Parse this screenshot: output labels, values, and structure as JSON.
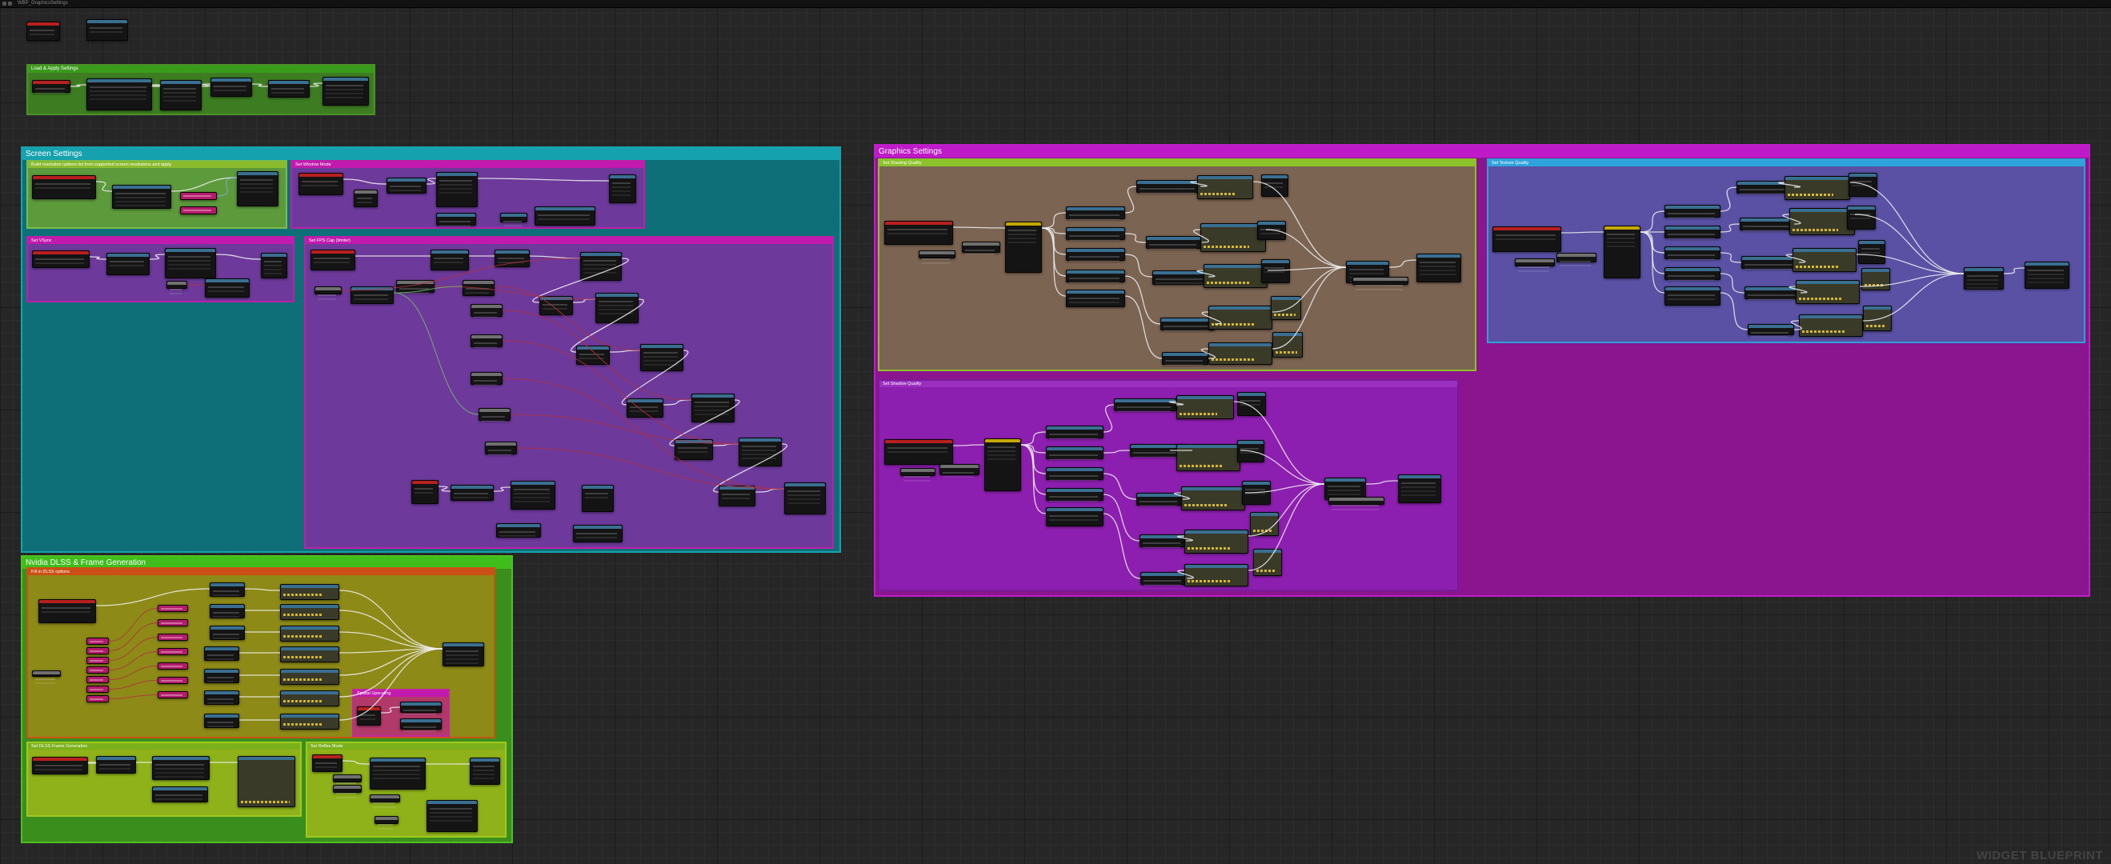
{
  "tab": {
    "label": "WBP_GraphicsSettings"
  },
  "watermark": "WIDGET BLUEPRINT",
  "comments": {
    "loadApply": "Load & Apply Settings",
    "screen": "Screen Settings",
    "resolution": "Build resolution options list from supported screen resolutions and apply",
    "setWindowMode": "Set Window Mode",
    "setVSync": "Set VSync",
    "setFpsCap": "Set FPS Cap (limiter)",
    "nvidia": "Nvidia DLSS & Frame Generation",
    "dlssOptions": "Fill in DLSS options",
    "upscaling": "Spatial Upscaling",
    "frameGen": "Set DLSS Frame Generation",
    "reflexMode": "Set Reflex Mode",
    "graphics": "Graphics Settings",
    "shadingQuality": "Set Shading Quality",
    "textureQuality": "Set Texture Quality",
    "shadowQuality": "Set Shadow Quality"
  },
  "colors": {
    "background": "#262626",
    "screenComment": "#0f6f78",
    "graphicsComment": "#8a158f",
    "nvidiaComment": "#3a8e1c",
    "eventHeader": "#b82020",
    "funcHeader": "#3b6f92"
  }
}
